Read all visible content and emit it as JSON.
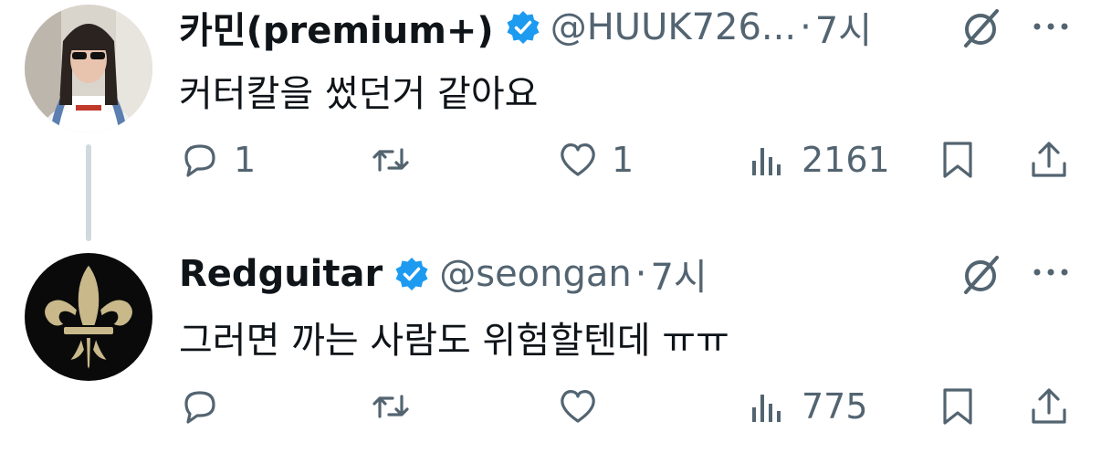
{
  "tweets": [
    {
      "name": "카민(premium+)",
      "handle": "@HUUK726...",
      "dot": "·",
      "time": "7시",
      "text": "커터칼을 썼던거 같아요",
      "reply_count": "1",
      "like_count": "1",
      "view_count": "2161",
      "avatar_icon": "profile-photo"
    },
    {
      "name": "Redguitar",
      "handle": "@seongan",
      "dot": "·",
      "time": "7시",
      "text": "그러면 까는 사람도 위험할텐데 ㅠㅠ",
      "reply_count": "",
      "like_count": "",
      "view_count": "775",
      "avatar_icon": "fleur-de-lis-icon"
    }
  ],
  "colors": {
    "verified": "#1d9bf0",
    "secondary_text": "#536471",
    "thread_line": "#cfd9de"
  }
}
